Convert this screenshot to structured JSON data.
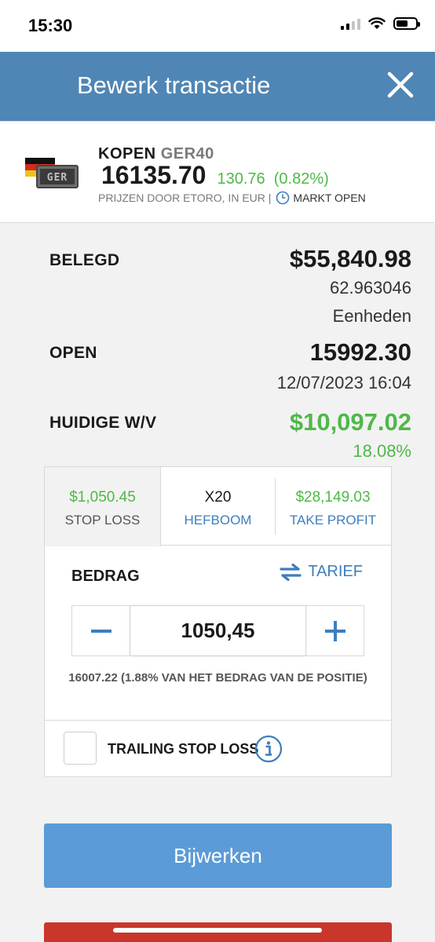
{
  "status_bar": {
    "time": "15:30"
  },
  "header": {
    "title": "Bewerk transactie"
  },
  "instrument": {
    "action": "KOPEN",
    "symbol": "GER40",
    "price": "16135.70",
    "change": "130.76",
    "change_pct": "(0.82%)",
    "source": "PRIJZEN DOOR ETORO, IN EUR |",
    "market_status": "MARKT OPEN",
    "logo_text": "GER"
  },
  "stats": {
    "invested_label": "BELEGD",
    "invested_value": "$55,840.98",
    "units_value": "62.963046",
    "units_label": "Eenheden",
    "open_label": "OPEN",
    "open_value": "15992.30",
    "open_datetime": "12/07/2023 16:04",
    "pl_label": "HUIDIGE W/V",
    "pl_value": "$10,097.02",
    "pl_pct": "18.08%"
  },
  "tabs": {
    "stop_loss_value": "$1,050.45",
    "stop_loss_label": "STOP LOSS",
    "leverage_value": "X20",
    "leverage_label": "HEFBOOM",
    "take_profit_value": "$28,149.03",
    "take_profit_label": "TAKE PROFIT"
  },
  "amount": {
    "label": "BEDRAG",
    "rate_label": "TARIEF",
    "value": "1050,45",
    "note": "16007.22 (1.88% VAN HET BEDRAG VAN DE POSITIE)"
  },
  "trailing": {
    "label": "TRAILING STOP LOSS",
    "checked": false
  },
  "buttons": {
    "update": "Bijwerken"
  },
  "colors": {
    "header": "#4f86b5",
    "accent_blue": "#3d7ebd",
    "positive_green": "#4fb848",
    "update_button": "#5b9bd7",
    "danger_red": "#c9372c"
  }
}
